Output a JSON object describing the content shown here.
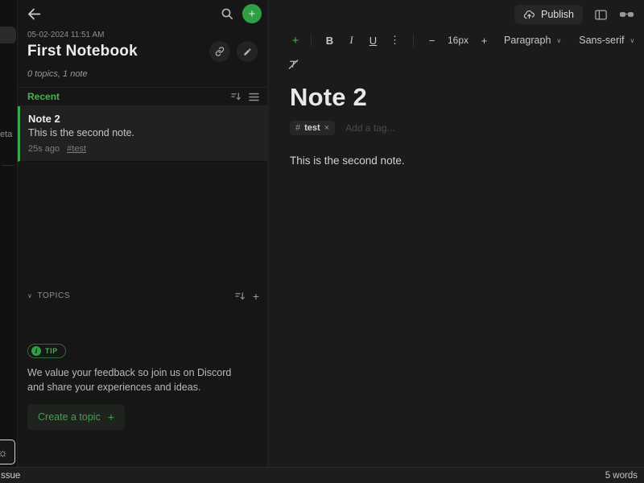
{
  "icons": {
    "more_vertical": "⋮",
    "chevron_down": "∨",
    "close": "×",
    "sun": "☼",
    "minus": "−",
    "plus": "+",
    "hash": "#",
    "info": "i"
  },
  "left_rail": {
    "beta_fragment": "eta"
  },
  "notes_panel": {
    "date": "05-02-2024 11:51 AM",
    "title": "First Notebook",
    "subtitle": "0 topics, 1 note",
    "recent_label": "Recent",
    "note": {
      "title": "Note 2",
      "preview": "This is the second note.",
      "time": "25s ago",
      "tag": "#test"
    },
    "topics_label": "TOPICS",
    "tip": {
      "badge": "TIP",
      "text": "We value your feedback so join us on Discord and share your experiences and ideas.",
      "cta": "Create a topic"
    }
  },
  "editor": {
    "publish_label": "Publish",
    "toolbar": {
      "bold": "B",
      "italic": "I",
      "underline": "U",
      "font_size": "16px",
      "paragraph_style": "Paragraph",
      "font_family": "Sans-serif"
    },
    "note_title": "Note 2",
    "tag": "test",
    "tag_placeholder": "Add a tag...",
    "body": "This is the second note."
  },
  "status_bar": {
    "left_fragment": "ssue",
    "word_count": "5 words"
  },
  "colors": {
    "accent_green": "#2f9e44",
    "green_text": "#4caf50",
    "panel_bg": "#161616",
    "editor_bg": "#1b1b1b",
    "note_selected_bg": "#212121"
  }
}
